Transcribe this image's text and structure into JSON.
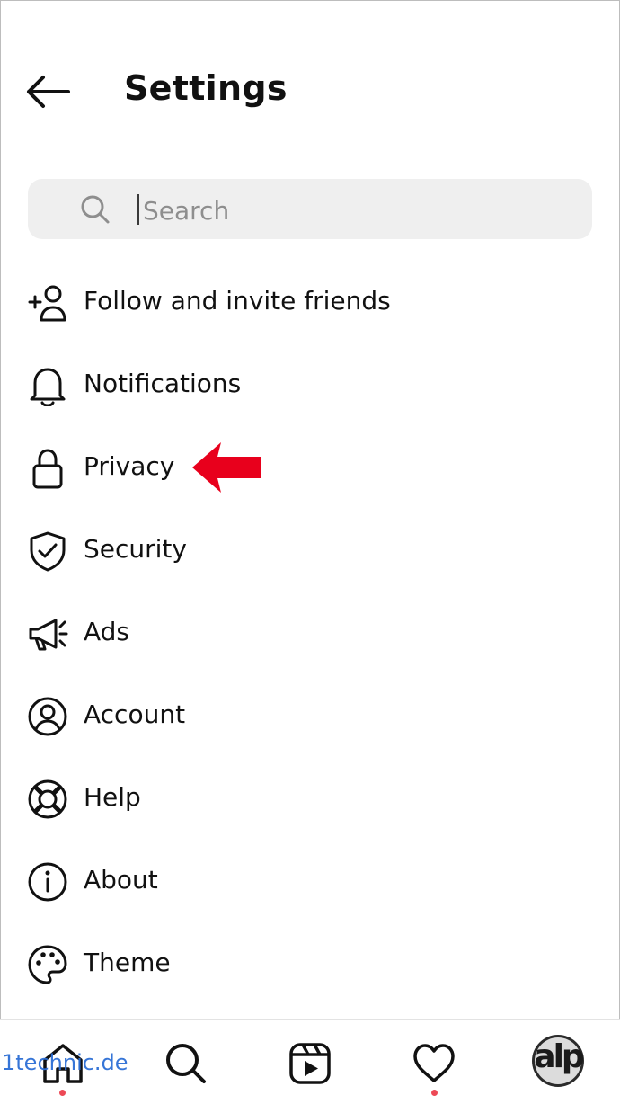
{
  "header": {
    "title": "Settings",
    "back_icon": "arrow-left-icon"
  },
  "search": {
    "placeholder": "Search",
    "value": "",
    "icon": "search-icon"
  },
  "menu": [
    {
      "label": "Follow and invite friends",
      "icon": "add-person-icon"
    },
    {
      "label": "Notifications",
      "icon": "bell-icon"
    },
    {
      "label": "Privacy",
      "icon": "lock-icon"
    },
    {
      "label": "Security",
      "icon": "shield-check-icon"
    },
    {
      "label": "Ads",
      "icon": "megaphone-icon"
    },
    {
      "label": "Account",
      "icon": "user-circle-icon"
    },
    {
      "label": "Help",
      "icon": "lifebuoy-icon"
    },
    {
      "label": "About",
      "icon": "info-icon"
    },
    {
      "label": "Theme",
      "icon": "palette-icon"
    }
  ],
  "annotation": {
    "icon": "red-arrow-icon",
    "color": "#e8001c",
    "target": "Privacy"
  },
  "navbar": {
    "items": [
      {
        "icon": "home-icon",
        "has_notification_dot": true
      },
      {
        "icon": "search-icon",
        "has_notification_dot": false
      },
      {
        "icon": "reels-icon",
        "has_notification_dot": false
      },
      {
        "icon": "heart-icon",
        "has_notification_dot": true
      },
      {
        "icon": "profile-avatar",
        "has_notification_dot": false
      }
    ],
    "avatar_text": "alp",
    "dot_color": "#ed4956"
  },
  "watermark": "1technic.de"
}
